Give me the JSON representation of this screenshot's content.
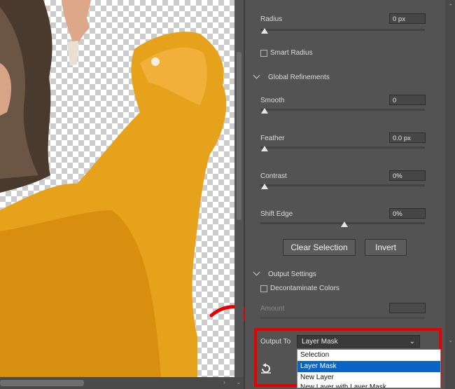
{
  "panel": {
    "radius": {
      "label": "Radius",
      "value": "0 px",
      "knob_fraction": 0.02
    },
    "smart_radius": {
      "label": "Smart Radius",
      "checked": false
    },
    "global_refinements": {
      "label": "Global Refinements"
    },
    "smooth": {
      "label": "Smooth",
      "value": "0",
      "knob_fraction": 0.02
    },
    "feather": {
      "label": "Feather",
      "value": "0.0 px",
      "knob_fraction": 0.02
    },
    "contrast": {
      "label": "Contrast",
      "value": "0%",
      "knob_fraction": 0.02
    },
    "shift_edge": {
      "label": "Shift Edge",
      "value": "0%",
      "knob_fraction": 0.5
    },
    "buttons": {
      "clear_selection": "Clear Selection",
      "invert": "Invert"
    },
    "output_settings": {
      "label": "Output Settings"
    },
    "decontaminate": {
      "label": "Decontaminate Colors",
      "checked": false
    },
    "amount": {
      "label": "Amount",
      "value": ""
    },
    "output_to": {
      "label": "Output To",
      "selected": "Layer Mask",
      "options": [
        "Selection",
        "Layer Mask",
        "New Layer",
        "New Layer with Layer Mask"
      ],
      "highlighted_index": 1
    }
  },
  "icons": {
    "reset": "reset-icon",
    "chevron": "chevron-down-icon",
    "annotation": "red-curved-arrow"
  },
  "colors": {
    "highlight_box": "#e60000",
    "selected_option": "#0a64c8",
    "panel_bg": "#535353"
  }
}
